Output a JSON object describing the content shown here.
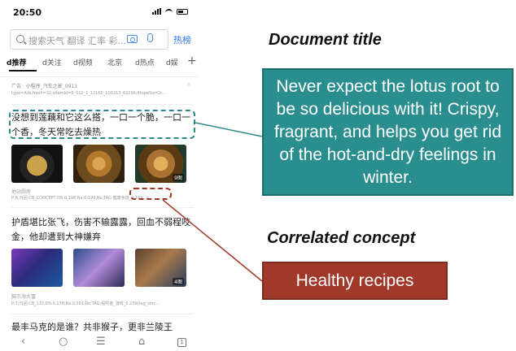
{
  "status_bar": {
    "time": "20:50"
  },
  "search": {
    "placeholder": "搜索天气 翻译 汇率 彩...",
    "hot_list": "热榜"
  },
  "tabs": [
    "d推荐",
    "d关注",
    "d视频",
    "北京",
    "d热点",
    "d娱"
  ],
  "feed": {
    "ad_label": "广告 · 小程序_汽车之家_0911",
    "ad_meta": "type=Ads,fresh=32,sitemId=6_512_1_12160_100213_82299;iHopeSortOr...",
    "article1": {
      "title": "没想到莲藕和它这么搭，一口一个脆，一口一个香，冬天常吃去燥热",
      "photo_count": "9图",
      "source": "地站厨房",
      "meta": "P:6;日回:CB_CONCEPT;DS:0.198;Ra:0.199;Re;TAG:健康食谱_0.169...s..."
    },
    "article2": {
      "title": "护盾堪比张飞，伤害不输露露，回血不弱程咬金，他却遭到大神嫌弃",
      "photo_count": "4图",
      "source": "脑示海大富",
      "meta": "P:7;日回:CB_115;DS:0.178;Ra:0.301;Re;TAG:程咬金_游戏_0.239(tag_sim;..."
    },
    "article3": {
      "title": "最丰马克的是谁？共非猴子，更非兰陵王"
    }
  },
  "bottom_nav": {
    "back": "‹",
    "refresh": "○",
    "menu": "☰",
    "home": "⌂",
    "tab_count": "1"
  },
  "annotations": {
    "document_title_label": "Document title",
    "document_title_text": "Never expect the lotus root to be so delicious with it! Crispy, fragrant, and helps you get rid of the hot-and-dry feelings in winter.",
    "correlated_concept_label": "Correlated concept",
    "correlated_concept_text": "Healthy recipes"
  },
  "colors": {
    "title_box": "#2b8e8e",
    "concept_box": "#a0392a",
    "accent_blue": "#3478f6"
  }
}
